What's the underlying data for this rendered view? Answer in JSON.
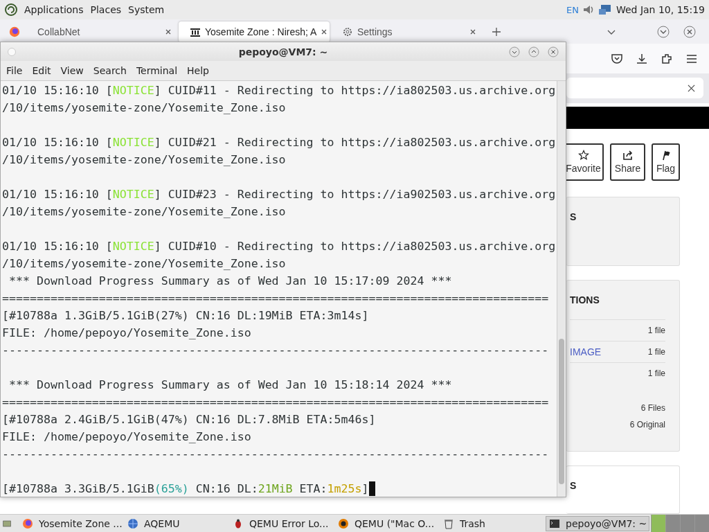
{
  "top_panel": {
    "menus": [
      "Applications",
      "Places",
      "System"
    ],
    "keyboard_layout": "EN",
    "clock": "Wed Jan 10, 15:19"
  },
  "browser": {
    "tabs": [
      {
        "label": "CollabNet",
        "selected": false,
        "kind": "page"
      },
      {
        "label": "Yosemite Zone : Niresh; A",
        "selected": true,
        "kind": "archive"
      },
      {
        "label": "Settings",
        "selected": false,
        "kind": "settings"
      }
    ],
    "action_buttons": [
      {
        "label": "Favorite",
        "kind": "star"
      },
      {
        "label": "Share",
        "kind": "share"
      },
      {
        "label": "Flag",
        "kind": "flag"
      }
    ],
    "cards": [
      {
        "title": "S",
        "kind": "gray"
      },
      {
        "title": "TIONS",
        "kind": "gray",
        "rows": [
          {
            "count": "1 file"
          },
          {
            "label": "IMAGE",
            "count": "1 file"
          },
          {
            "count": "1 file"
          }
        ],
        "totals": [
          "6 Files",
          "6 Original"
        ]
      },
      {
        "title": "S",
        "kind": "white"
      }
    ]
  },
  "terminal": {
    "title": "pepoyo@VM7: ~",
    "menus": [
      "File",
      "Edit",
      "View",
      "Search",
      "Terminal",
      "Help"
    ],
    "blocks": [
      {
        "lines": [
          {
            "segments": [
              {
                "text": "01/10 15:16:10 ["
              },
              {
                "text": "NOTICE",
                "color": "#8ae234"
              },
              {
                "text": "] CUID#11 - Redirecting to https://ia802503.us.archive.org"
              }
            ]
          },
          {
            "segments": [
              {
                "text": "/10/items/yosemite-zone/Yosemite_Zone.iso"
              }
            ]
          }
        ]
      },
      {
        "lines": [
          {
            "segments": [
              {
                "text": "01/10 15:16:10 ["
              },
              {
                "text": "NOTICE",
                "color": "#8ae234"
              },
              {
                "text": "] CUID#21 - Redirecting to https://ia802503.us.archive.org"
              }
            ]
          },
          {
            "segments": [
              {
                "text": "/10/items/yosemite-zone/Yosemite_Zone.iso"
              }
            ]
          }
        ]
      },
      {
        "lines": [
          {
            "segments": [
              {
                "text": "01/10 15:16:10 ["
              },
              {
                "text": "NOTICE",
                "color": "#8ae234"
              },
              {
                "text": "] CUID#23 - Redirecting to https://ia902503.us.archive.org"
              }
            ]
          },
          {
            "segments": [
              {
                "text": "/10/items/yosemite-zone/Yosemite_Zone.iso"
              }
            ]
          }
        ]
      },
      {
        "lines": [
          {
            "segments": [
              {
                "text": "01/10 15:16:10 ["
              },
              {
                "text": "NOTICE",
                "color": "#8ae234"
              },
              {
                "text": "] CUID#10 - Redirecting to https://ia802503.us.archive.org"
              }
            ]
          },
          {
            "segments": [
              {
                "text": "/10/items/yosemite-zone/Yosemite_Zone.iso"
              }
            ]
          },
          {
            "segments": [
              {
                "text": " *** Download Progress Summary as of Wed Jan 10 15:17:09 2024 ***"
              }
            ]
          },
          {
            "segments": [
              {
                "text": "==============================================================================="
              }
            ]
          },
          {
            "segments": [
              {
                "text": "[#10788a 1.3GiB/5.1GiB(27%) CN:16 DL:19MiB ETA:3m14s]"
              }
            ]
          },
          {
            "segments": [
              {
                "text": "FILE: /home/pepoyo/Yosemite_Zone.iso"
              }
            ]
          },
          {
            "segments": [
              {
                "text": "-------------------------------------------------------------------------------"
              }
            ]
          }
        ]
      },
      {
        "lines": [
          {
            "segments": [
              {
                "text": " *** Download Progress Summary as of Wed Jan 10 15:18:14 2024 ***"
              }
            ]
          },
          {
            "segments": [
              {
                "text": "==============================================================================="
              }
            ]
          },
          {
            "segments": [
              {
                "text": "[#10788a 2.4GiB/5.1GiB(47%) CN:16 DL:7.8MiB ETA:5m46s]"
              }
            ]
          },
          {
            "segments": [
              {
                "text": "FILE: /home/pepoyo/Yosemite_Zone.iso"
              }
            ]
          },
          {
            "segments": [
              {
                "text": "-------------------------------------------------------------------------------"
              }
            ]
          }
        ]
      },
      {
        "lines": [
          {
            "segments": [
              {
                "text": "[#10788a 3.3GiB/5.1GiB"
              },
              {
                "text": "(65%)",
                "color": "#2aa198"
              },
              {
                "text": " CN:16 DL:"
              },
              {
                "text": "21MiB",
                "color": "#6ea51e"
              },
              {
                "text": " ETA:"
              },
              {
                "text": "1m25s",
                "color": "#c4a000"
              },
              {
                "text": "]"
              }
            ],
            "cursor": true
          }
        ]
      }
    ]
  },
  "taskbar": {
    "items": [
      {
        "label": "Yosemite Zone ...",
        "kind": "firefox",
        "selected": false
      },
      {
        "label": "AQEMU",
        "kind": "globe",
        "selected": false
      },
      {
        "label": "QEMU Error Lo...",
        "kind": "bug",
        "selected": false
      },
      {
        "label": "QEMU (\"Mac O...",
        "kind": "qemu",
        "selected": false
      },
      {
        "label": "Trash",
        "kind": "trash",
        "selected": false
      },
      {
        "label": "pepoyo@VM7: ~",
        "kind": "terminal",
        "selected": true
      }
    ],
    "workspaces": [
      {
        "selected": true
      },
      {
        "selected": false
      },
      {
        "selected": false
      },
      {
        "selected": false
      }
    ]
  }
}
